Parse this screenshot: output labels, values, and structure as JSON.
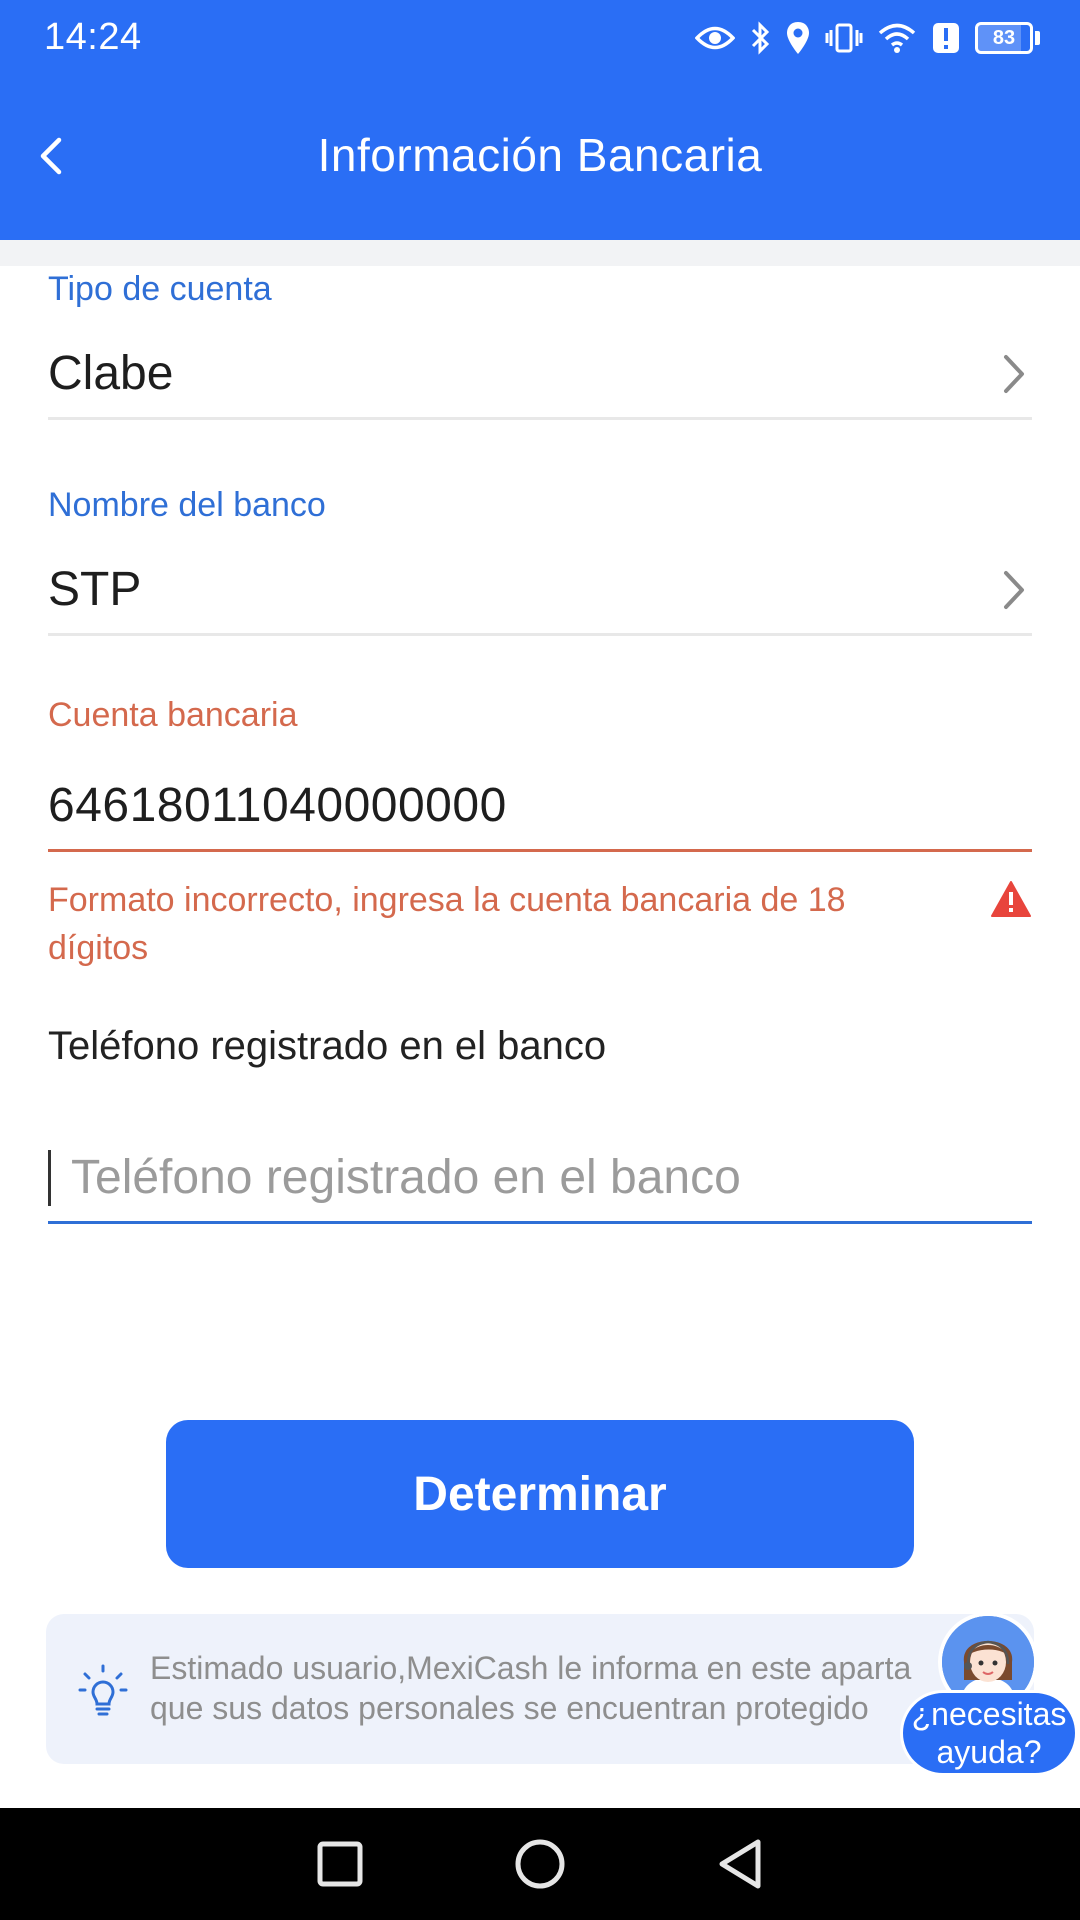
{
  "status_bar": {
    "time": "14:24",
    "battery_level": "83",
    "icons": [
      "eye-icon",
      "bluetooth-icon",
      "location-icon",
      "vibrate-icon",
      "wifi-icon",
      "alert-icon",
      "battery-icon"
    ]
  },
  "header": {
    "title": "Información Bancaria",
    "back_icon": "chevron-left-icon"
  },
  "form": {
    "account_type": {
      "label": "Tipo de cuenta",
      "value": "Clabe"
    },
    "bank_name": {
      "label": "Nombre del banco",
      "value": "STP"
    },
    "bank_account": {
      "label": "Cuenta bancaria",
      "value": "64618011040000000",
      "error": "Formato incorrecto, ingresa la cuenta bancaria de 18 dígitos"
    },
    "phone": {
      "label": "Teléfono registrado en el banco",
      "placeholder": "Teléfono registrado en el banco",
      "value": ""
    }
  },
  "submit_label": "Determinar",
  "notice": {
    "line1": "Estimado usuario,MexiCash le informa en este aparta",
    "line2": "que sus datos personales se encuentran protegido"
  },
  "help": {
    "line1": "¿necesitas",
    "line2": "ayuda?"
  },
  "colors": {
    "primary": "#2a6ef5",
    "label_blue": "#2f6fd6",
    "error": "#d4694d",
    "warning_red": "#e8453c"
  }
}
